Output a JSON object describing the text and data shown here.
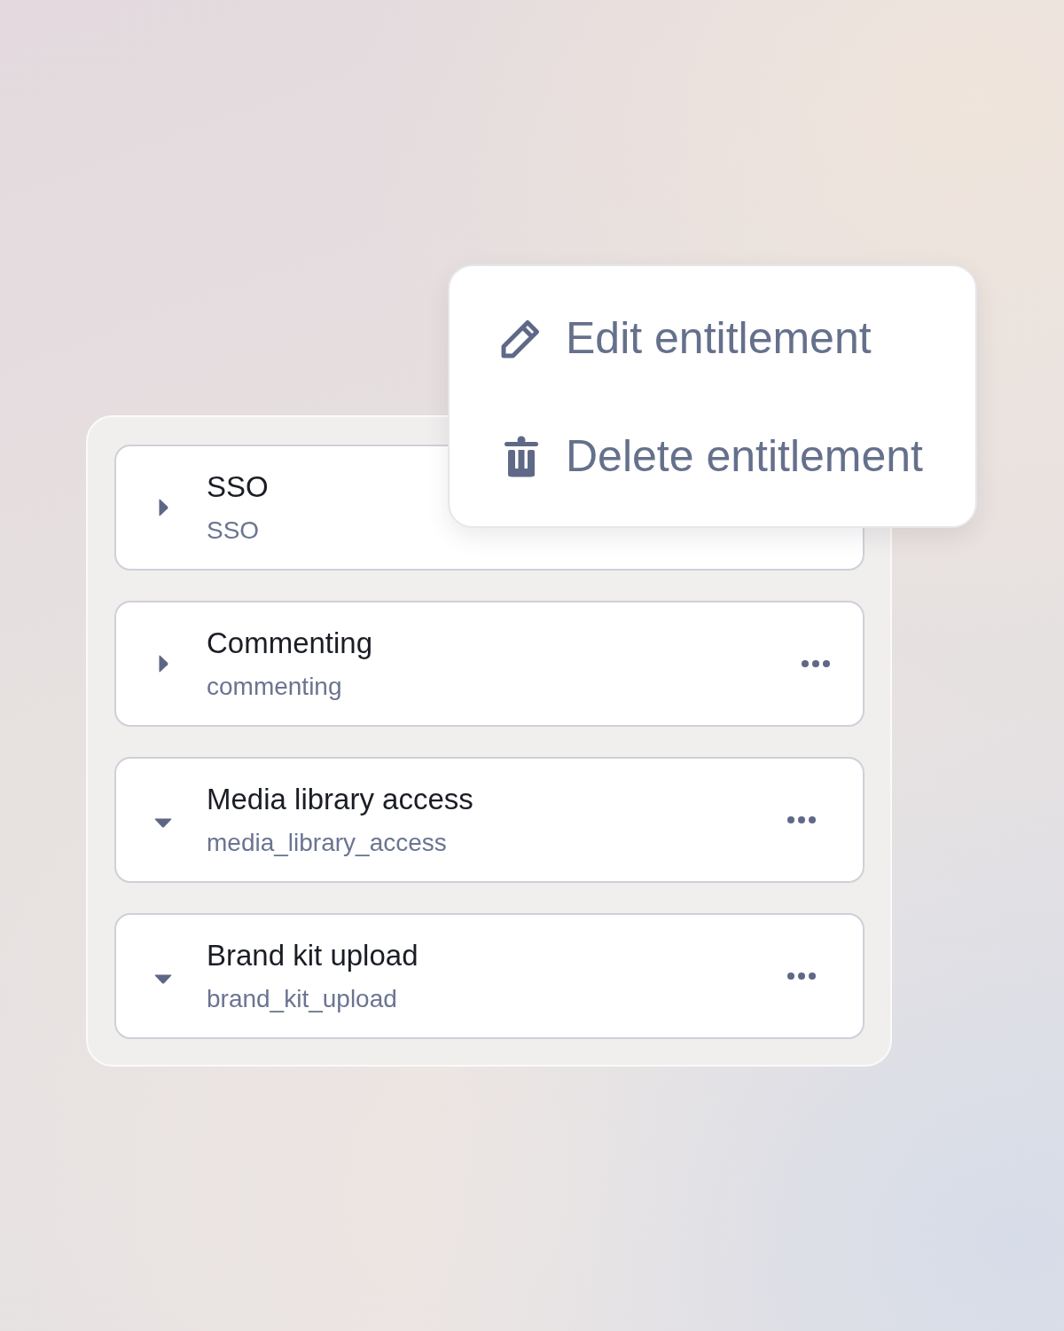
{
  "entitlements": [
    {
      "name": "SSO",
      "key": "SSO",
      "expanded": false,
      "menu_open": true
    },
    {
      "name": "Commenting",
      "key": "commenting",
      "expanded": false,
      "menu_open": false
    },
    {
      "name": "Media library access",
      "key": "media_library_access",
      "expanded": true,
      "menu_open": false
    },
    {
      "name": "Brand kit upload",
      "key": "brand_kit_upload",
      "expanded": true,
      "menu_open": false
    }
  ],
  "context_menu": {
    "items": [
      {
        "kind": "edit",
        "label": "Edit entitlement"
      },
      {
        "kind": "delete",
        "label": "Delete entitlement"
      }
    ]
  }
}
